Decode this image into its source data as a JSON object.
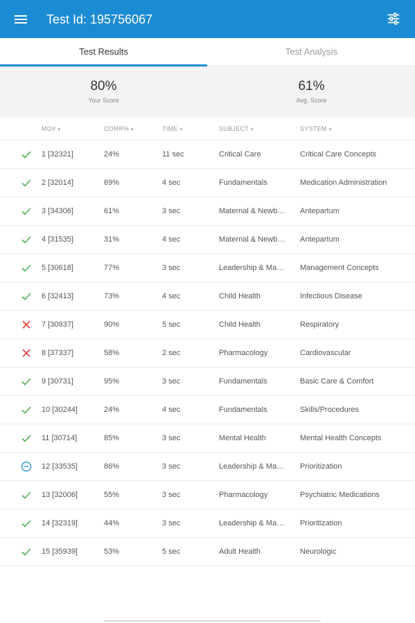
{
  "appbar": {
    "title": "Test Id: 195756067",
    "menu_icon": "hamburger-menu-icon",
    "filter_icon": "sliders-filter-icon",
    "color": "#1b8bd3"
  },
  "tabs": [
    {
      "label": "Test Results",
      "active": true
    },
    {
      "label": "Test Analysis",
      "active": false
    }
  ],
  "scores": {
    "your": {
      "value": "80%",
      "label": "Your Score"
    },
    "avg": {
      "value": "61%",
      "label": "Avg. Score"
    }
  },
  "columns": [
    {
      "label": "MO#"
    },
    {
      "label": "CORR%"
    },
    {
      "label": "TIME"
    },
    {
      "label": "SUBJECT"
    },
    {
      "label": "SYSTEM"
    }
  ],
  "status_colors": {
    "correct": "#4caf50",
    "incorrect": "#e53935",
    "omitted": "#1b8bd3"
  },
  "rows": [
    {
      "status": "correct",
      "qid": "1 [32321]",
      "corr": "24%",
      "time": "11 sec",
      "subject": "Critical Care",
      "system": "Critical Care Concepts"
    },
    {
      "status": "correct",
      "qid": "2 [32014]",
      "corr": "69%",
      "time": "4 sec",
      "subject": "Fundamentals",
      "system": "Medication Administration"
    },
    {
      "status": "correct",
      "qid": "3 [34306]",
      "corr": "61%",
      "time": "3 sec",
      "subject": "Maternal & Newb…",
      "system": "Antepartum"
    },
    {
      "status": "correct",
      "qid": "4 [31535]",
      "corr": "31%",
      "time": "4 sec",
      "subject": "Maternal & Newb…",
      "system": "Antepartum"
    },
    {
      "status": "correct",
      "qid": "5 [30618]",
      "corr": "77%",
      "time": "3 sec",
      "subject": "Leadership & Ma…",
      "system": "Management Concepts"
    },
    {
      "status": "correct",
      "qid": "6 [32413]",
      "corr": "73%",
      "time": "4 sec",
      "subject": "Child Health",
      "system": "Infectious Disease"
    },
    {
      "status": "incorrect",
      "qid": "7 [30937]",
      "corr": "90%",
      "time": "5 sec",
      "subject": "Child Health",
      "system": "Respiratory"
    },
    {
      "status": "incorrect",
      "qid": "8 [37337]",
      "corr": "58%",
      "time": "2 sec",
      "subject": "Pharmacology",
      "system": "Cardiovascular"
    },
    {
      "status": "correct",
      "qid": "9 [30731]",
      "corr": "95%",
      "time": "3 sec",
      "subject": "Fundamentals",
      "system": "Basic Care & Comfort"
    },
    {
      "status": "correct",
      "qid": "10 [30244]",
      "corr": "24%",
      "time": "4 sec",
      "subject": "Fundamentals",
      "system": "Skills/Procedures"
    },
    {
      "status": "correct",
      "qid": "11 [30714]",
      "corr": "85%",
      "time": "3 sec",
      "subject": "Mental Health",
      "system": "Mental Health Concepts"
    },
    {
      "status": "omitted",
      "qid": "12 [33535]",
      "corr": "86%",
      "time": "3 sec",
      "subject": "Leadership & Ma…",
      "system": "Prioritization"
    },
    {
      "status": "correct",
      "qid": "13 [32006]",
      "corr": "55%",
      "time": "3 sec",
      "subject": "Pharmacology",
      "system": "Psychiatric Medications"
    },
    {
      "status": "correct",
      "qid": "14 [32319]",
      "corr": "44%",
      "time": "3 sec",
      "subject": "Leadership & Ma…",
      "system": "Prioritization"
    },
    {
      "status": "correct",
      "qid": "15 [35939]",
      "corr": "53%",
      "time": "5 sec",
      "subject": "Adult Health",
      "system": "Neurologic"
    }
  ]
}
